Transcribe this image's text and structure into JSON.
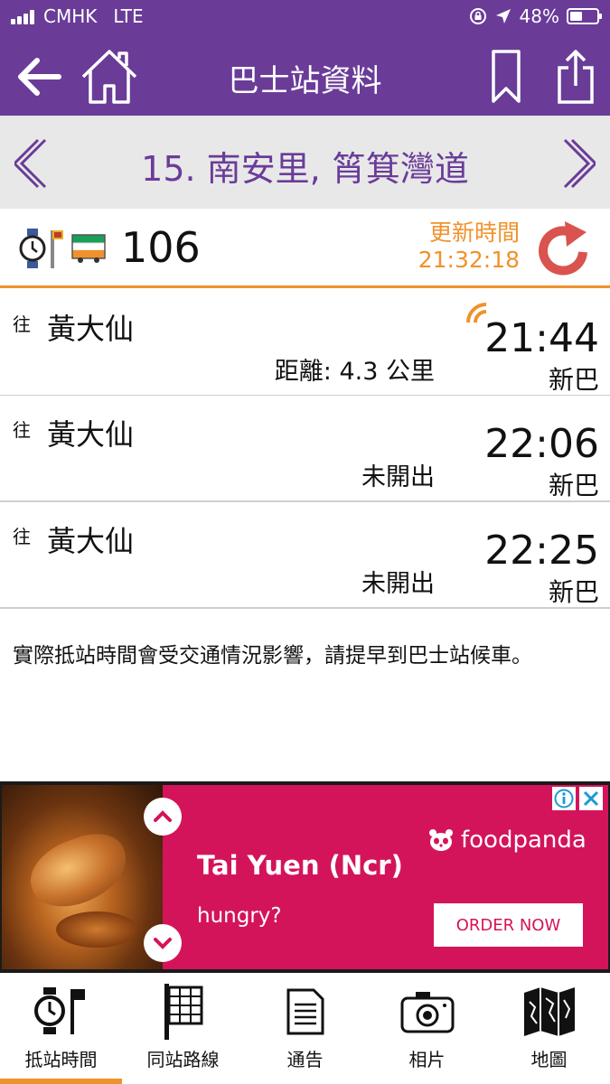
{
  "status_bar": {
    "carrier": "CMHK",
    "network": "LTE",
    "battery": "48%",
    "battery_level": 0.48
  },
  "header": {
    "title": "巴士站資料",
    "icons": [
      "back-arrow-icon",
      "home-icon",
      "bookmark-icon",
      "share-icon"
    ]
  },
  "stop": {
    "name": "15. 南安里, 筲箕灣道"
  },
  "route": {
    "number": "106",
    "update_label": "更新時間",
    "update_time": "21:32:18"
  },
  "eta": [
    {
      "to_label": "往",
      "destination": "黃大仙",
      "note": "距離: 4.3 公里",
      "time": "21:44",
      "company": "新巴",
      "realtime": true
    },
    {
      "to_label": "往",
      "destination": "黃大仙",
      "note": "未開出",
      "time": "22:06",
      "company": "新巴",
      "realtime": false
    },
    {
      "to_label": "往",
      "destination": "黃大仙",
      "note": "未開出",
      "time": "22:25",
      "company": "新巴",
      "realtime": false
    }
  ],
  "notice": "實際抵站時間會受交通情況影響，請提早到巴士站候車。",
  "ad": {
    "brand": "foodpanda",
    "title": "Tai Yuen (Ncr)",
    "subtitle": "hungry?",
    "cta": "ORDER NOW",
    "accent": "#d4145a"
  },
  "tabs": [
    {
      "label": "抵站時間",
      "icon": "eta-clock-icon",
      "active": true
    },
    {
      "label": "同站路線",
      "icon": "stop-routes-icon",
      "active": false
    },
    {
      "label": "通告",
      "icon": "notice-icon",
      "active": false
    },
    {
      "label": "相片",
      "icon": "camera-icon",
      "active": false
    },
    {
      "label": "地圖",
      "icon": "map-icon",
      "active": false
    }
  ],
  "colors": {
    "primary": "#6a3c98",
    "accent": "#f0922b",
    "refresh": "#d9534f"
  }
}
